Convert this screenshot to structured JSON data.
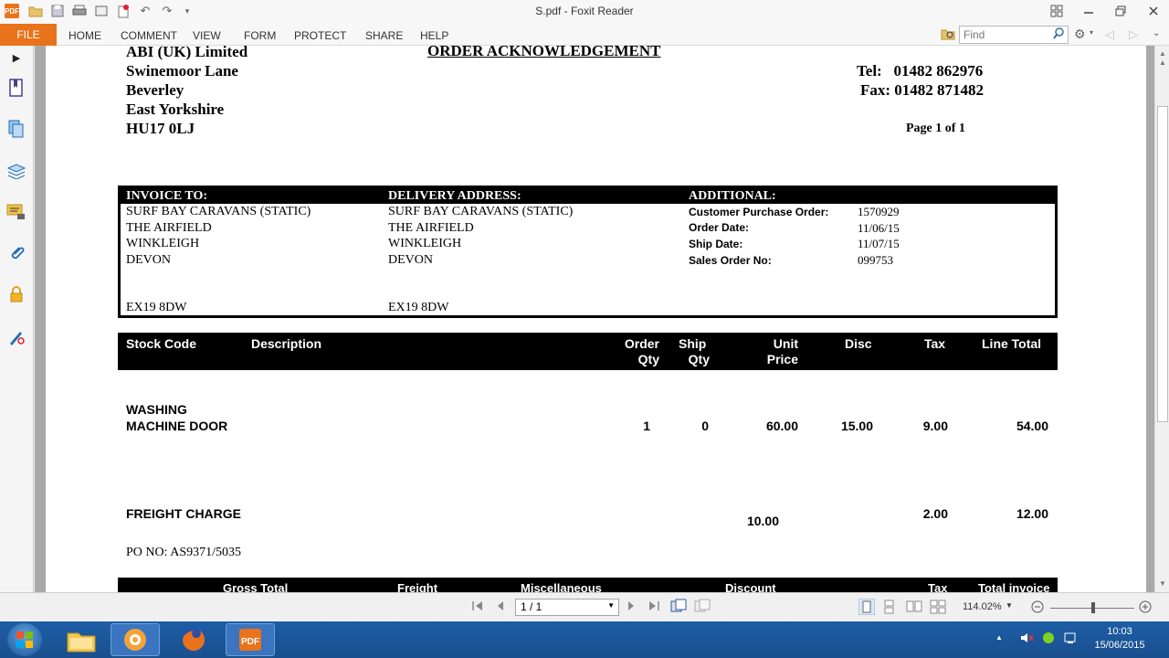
{
  "window": {
    "title": "S.pdf - Foxit Reader",
    "logo": "PDF"
  },
  "ribbon": {
    "file_label": "FILE",
    "tabs": [
      "HOME",
      "COMMENT",
      "VIEW",
      "FORM",
      "PROTECT",
      "SHARE",
      "HELP"
    ],
    "find_placeholder": "Find"
  },
  "document": {
    "company_lines": [
      "ABI (UK) Limited",
      "Swinemoor Lane",
      "Beverley",
      "East Yorkshire",
      "HU17 0LJ"
    ],
    "heading": "ORDER ACKNOWLEDGEMENT",
    "tel": "Tel:   01482 862976",
    "fax": "Fax: 01482 871482",
    "page_count": "Page 1 of 1",
    "invoice_to": {
      "label": "INVOICE TO:",
      "lines": [
        "SURF BAY CARAVANS (STATIC)",
        "THE AIRFIELD",
        "WINKLEIGH",
        "DEVON"
      ],
      "postcode": "EX19 8DW"
    },
    "delivery": {
      "label": "DELIVERY ADDRESS:",
      "lines": [
        "SURF BAY CARAVANS (STATIC)",
        "THE AIRFIELD",
        "WINKLEIGH",
        "DEVON"
      ],
      "postcode": "EX19 8DW"
    },
    "additional": {
      "label": "ADDITIONAL:",
      "fields": [
        {
          "label": "Customer Purchase Order:",
          "value": "1570929"
        },
        {
          "label": "Order Date:",
          "value": "11/06/15"
        },
        {
          "label": "Ship Date:",
          "value": "11/07/15"
        },
        {
          "label": "Sales Order No:",
          "value": "099753"
        }
      ]
    },
    "columns": {
      "stock_code": "Stock Code",
      "description": "Description",
      "order_qty_1": "Order",
      "order_qty_2": "Qty",
      "ship_qty_1": "Ship",
      "ship_qty_2": "Qty",
      "unit_price_1": "Unit",
      "unit_price_2": "Price",
      "disc": "Disc",
      "tax": "Tax",
      "line_total": "Line Total"
    },
    "item": {
      "code_1": "WASHING",
      "code_2": "MACHINE DOOR",
      "order_qty": "1",
      "ship_qty": "0",
      "unit_price": "60.00",
      "disc": "15.00",
      "tax": "9.00",
      "line_total": "54.00"
    },
    "freight": {
      "label": "FREIGHT CHARGE",
      "unit_price": "10.00",
      "tax": "2.00",
      "line_total": "12.00"
    },
    "po_no": "PO NO: AS9371/5035",
    "totals_headers": {
      "gross_total": "Gross Total",
      "freight": "Freight",
      "misc": "Miscellaneous",
      "discount": "Discount",
      "tax": "Tax",
      "total_invoice": "Total invoice"
    }
  },
  "nav": {
    "page_value": "1 / 1",
    "zoom": "114.02%"
  },
  "taskbar": {
    "time": "10:03",
    "date": "15/06/2015"
  },
  "colors": {
    "accent": "#e8731a",
    "taskbar": "#1d5ea6",
    "doc_header": "#000000"
  }
}
